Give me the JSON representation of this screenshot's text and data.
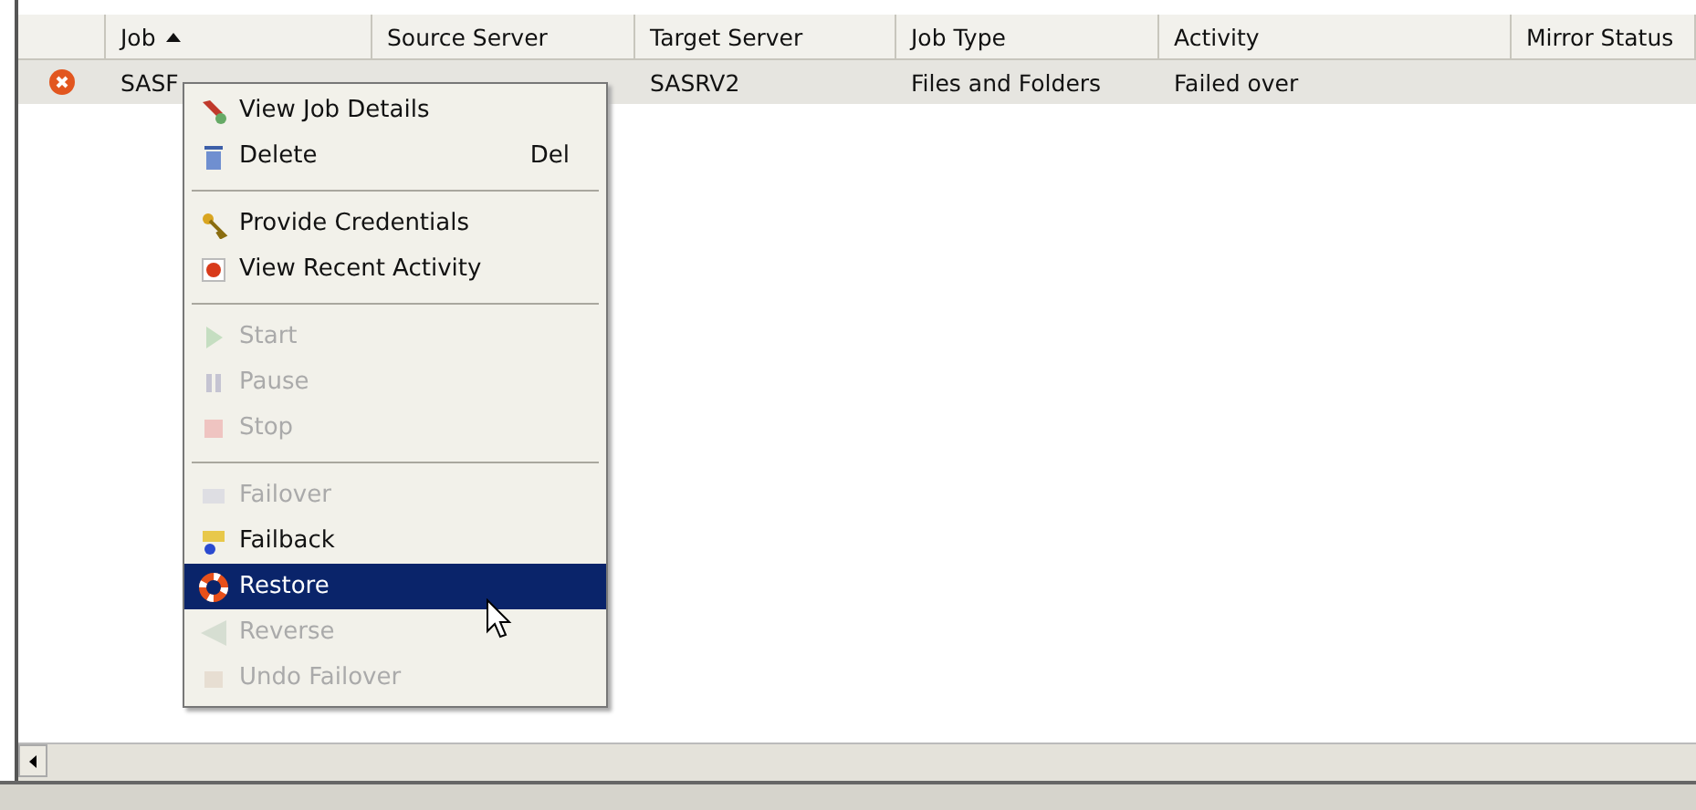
{
  "table": {
    "columns": [
      {
        "label": "Job",
        "sorted": true
      },
      {
        "label": "Source Server",
        "sorted": false
      },
      {
        "label": "Target Server",
        "sorted": false
      },
      {
        "label": "Job Type",
        "sorted": false
      },
      {
        "label": "Activity",
        "sorted": false
      },
      {
        "label": "Mirror Status",
        "sorted": false
      }
    ],
    "rows": [
      {
        "error": true,
        "selected": true,
        "job": "SASF",
        "target_server": "SASRV2",
        "job_type": "Files and Folders",
        "activity": "Failed over"
      }
    ]
  },
  "context_menu": {
    "items": [
      {
        "kind": "item",
        "label": "View Job Details",
        "disabled": false,
        "selected": false
      },
      {
        "kind": "item",
        "label": "Delete",
        "shortcut": "Del",
        "disabled": false,
        "selected": false
      },
      {
        "kind": "separator"
      },
      {
        "kind": "item",
        "label": "Provide Credentials",
        "disabled": false,
        "selected": false
      },
      {
        "kind": "item",
        "label": "View Recent Activity",
        "disabled": false,
        "selected": false
      },
      {
        "kind": "separator"
      },
      {
        "kind": "item",
        "label": "Start",
        "disabled": true,
        "selected": false
      },
      {
        "kind": "item",
        "label": "Pause",
        "disabled": true,
        "selected": false
      },
      {
        "kind": "item",
        "label": "Stop",
        "disabled": true,
        "selected": false
      },
      {
        "kind": "separator"
      },
      {
        "kind": "item",
        "label": "Failover",
        "disabled": true,
        "selected": false
      },
      {
        "kind": "item",
        "label": "Failback",
        "disabled": false,
        "selected": false
      },
      {
        "kind": "item",
        "label": "Restore",
        "disabled": false,
        "selected": true
      },
      {
        "kind": "item",
        "label": "Reverse",
        "disabled": true,
        "selected": false
      },
      {
        "kind": "item",
        "label": "Undo Failover",
        "disabled": true,
        "selected": false
      }
    ]
  }
}
